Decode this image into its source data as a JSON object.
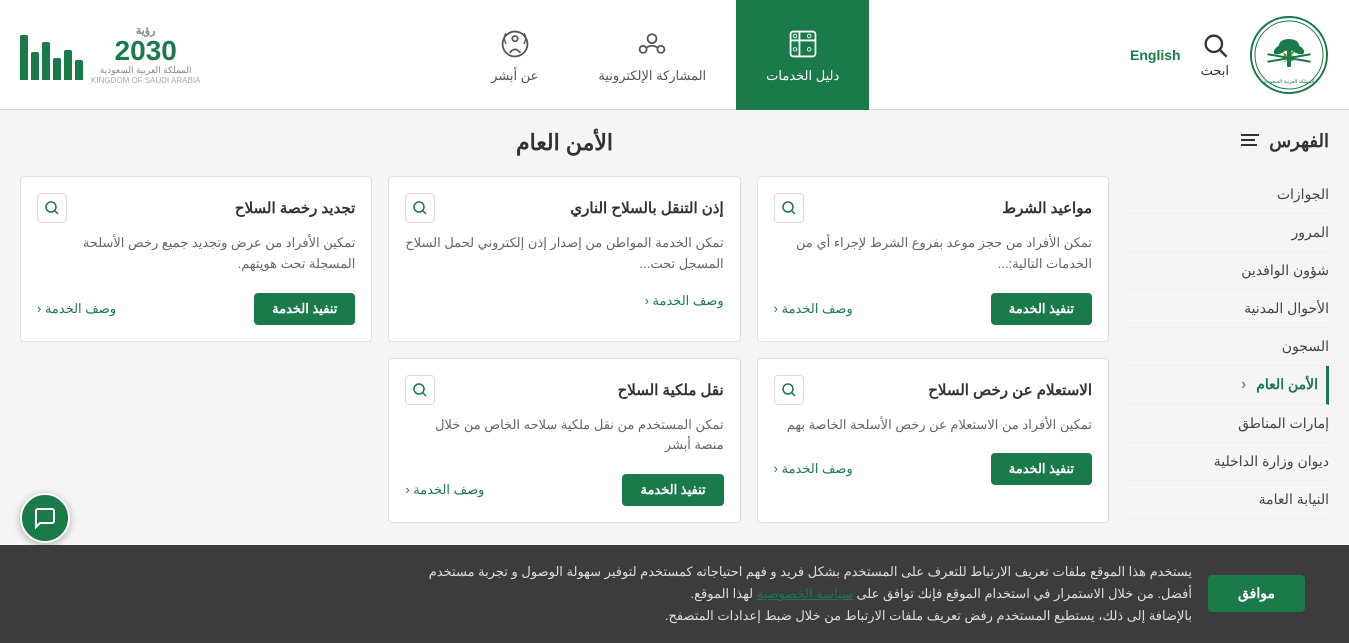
{
  "header": {
    "search_label": "ابحث",
    "lang_label": "English",
    "nav_tabs": [
      {
        "id": "services-guide",
        "label": "دليل الخدمات",
        "active": true
      },
      {
        "id": "electronic-participation",
        "label": "المشاركة الإلكترونية",
        "active": false
      },
      {
        "id": "about-absher",
        "label": "عن أبشر",
        "active": false
      }
    ]
  },
  "vision": {
    "title": "رؤية",
    "year": "2030",
    "subtitle": "المملكة العربية السعودية",
    "country": "KINGDOM OF SAUDI ARABIA"
  },
  "sidebar": {
    "title": "الفهرس",
    "items": [
      {
        "id": "passports",
        "label": "الجوازات",
        "active": false
      },
      {
        "id": "traffic",
        "label": "المرور",
        "active": false
      },
      {
        "id": "expats",
        "label": "شؤون الوافدين",
        "active": false
      },
      {
        "id": "civil-affairs",
        "label": "الأحوال المدنية",
        "active": false
      },
      {
        "id": "prisons",
        "label": "السجون",
        "active": false
      },
      {
        "id": "public-security",
        "label": "الأمن العام",
        "active": true
      },
      {
        "id": "emirates-regions",
        "label": "إمارات المناطق",
        "active": false
      },
      {
        "id": "interior-ministry",
        "label": "ديوان وزارة الداخلية",
        "active": false
      },
      {
        "id": "general-secretariat",
        "label": "النيابة العامة",
        "active": false
      }
    ]
  },
  "section_title": "الأمن العام",
  "cards": [
    {
      "id": "police-appointments",
      "title": "مواعيد الشرط",
      "desc": "تمكن الأفراد من حجز موعد بفروع الشرط لإجراء أي من الخدمات التالية:...",
      "has_execute": true,
      "execute_label": "تنفيذ الخدمة",
      "desc_label": "وصف الخدمة ‹"
    },
    {
      "id": "firearm-permit",
      "title": "إذن التنقل بالسلاح الناري",
      "desc": "تمكن الخدمة المواطن من إصدار إذن إلكتروني لحمل السلاح المسجل تحت...",
      "has_execute": false,
      "execute_label": "",
      "desc_label": "وصف الخدمة ‹"
    },
    {
      "id": "renew-weapon-license",
      "title": "تجديد رخصة السلاح",
      "desc": "تمكين الأفراد من عرض وتجديد جميع رخص الأسلحة المسجلة تحت هويتهم.",
      "has_execute": false,
      "execute_label": "تنفيذ الخدمة",
      "desc_label": "وصف الخدمة ‹"
    },
    {
      "id": "weapon-licenses-inquiry",
      "title": "الاستعلام عن رخص السلاح",
      "desc": "تمكين الأفراد من الاستعلام عن رخص الأسلحة الخاصة بهم",
      "has_execute": true,
      "execute_label": "تنفيذ الخدمة",
      "desc_label": "وصف الخدمة ‹"
    },
    {
      "id": "transfer-weapon-ownership",
      "title": "نقل ملكية السلاح",
      "desc": "تمكن المستخدم من نقل ملكية سلاحه الخاص من خلال منصة أبشر",
      "has_execute": false,
      "execute_label": "تنفيذ الخدمة",
      "desc_label": "وصف الخدمة ‹"
    }
  ],
  "cookie": {
    "text_line1": "يستخدم هذا الموقع ملفات تعريف الارتباط للتعرف على المستخدم بشكل فريد و فهم احتياجاته كمستخدم لتوفير سهولة الوصول و تجربة مستخدم",
    "text_line2": "أفضل. من خلال الاستمرار في استخدام الموقع فإنك توافق على",
    "policy_link": "سياسة الخصوصية",
    "text_line3": "لهذا الموقع.",
    "text_line4": "بالإضافة إلى ذلك، يستطيع المستخدم رفض تعريف ملفات الارتباط من خلال ضبط إعدادات المتصفح.",
    "accept_label": "موافق"
  }
}
